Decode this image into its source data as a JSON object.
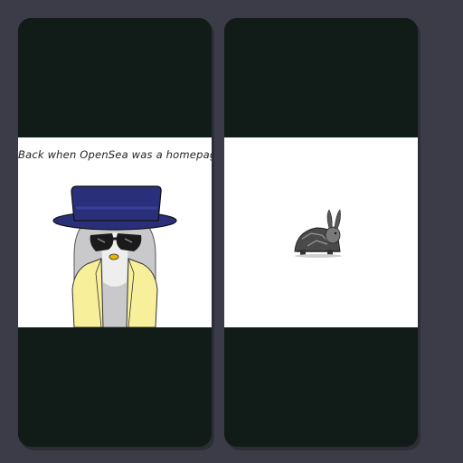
{
  "cards": [
    {
      "caption": "Back when OpenSea was a homepage",
      "image_subject": "penguin-in-top-hat-icon"
    },
    {
      "image_subject": "tortoise-rabbit-hybrid-icon"
    }
  ],
  "colors": {
    "page_background": "#3b3c47",
    "card_background": "#111b17",
    "media_background": "#ffffff",
    "hat": "#2a2f7a",
    "coat": "#f7ef9a"
  }
}
